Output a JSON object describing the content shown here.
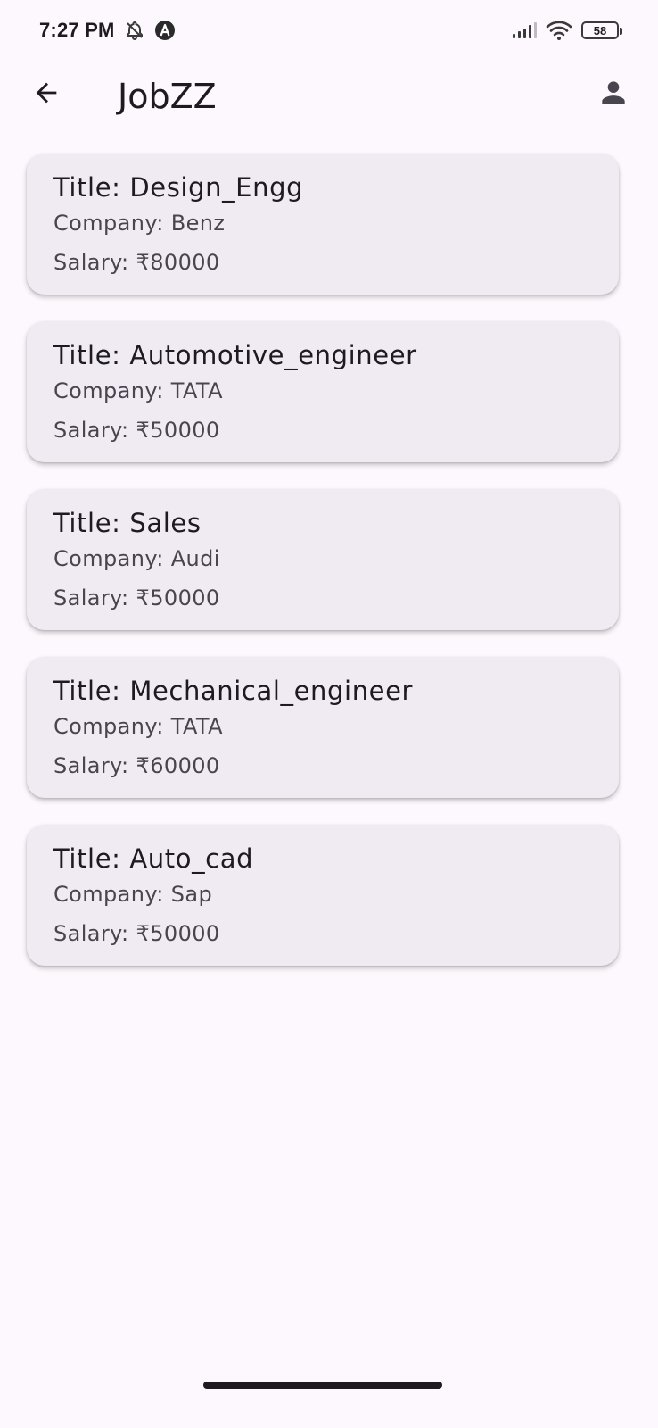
{
  "status_bar": {
    "time": "7:27 PM",
    "icons": [
      "notifications-off-icon",
      "autoplay-a-icon",
      "signal-icon",
      "wifi-icon"
    ],
    "battery_level": "58"
  },
  "app_bar": {
    "title": "JobZZ",
    "back_icon": "arrow-left-icon",
    "profile_icon": "person-icon"
  },
  "jobs": [
    {
      "title": "Title: Design_Engg",
      "company": "Company: Benz",
      "salary": "Salary: ₹80000"
    },
    {
      "title": "Title: Automotive_engineer",
      "company": "Company: TATA",
      "salary": "Salary: ₹50000"
    },
    {
      "title": "Title: Sales",
      "company": "Company: Audi",
      "salary": "Salary: ₹50000"
    },
    {
      "title": "Title: Mechanical_engineer",
      "company": "Company: TATA",
      "salary": "Salary: ₹60000"
    },
    {
      "title": "Title: Auto_cad",
      "company": "Company: Sap",
      "salary": "Salary: ₹50000"
    }
  ],
  "colors": {
    "background": "#fdf8fd",
    "card": "#f0ebf3",
    "primary_text": "#1d1b20",
    "secondary_text": "#49454f"
  }
}
